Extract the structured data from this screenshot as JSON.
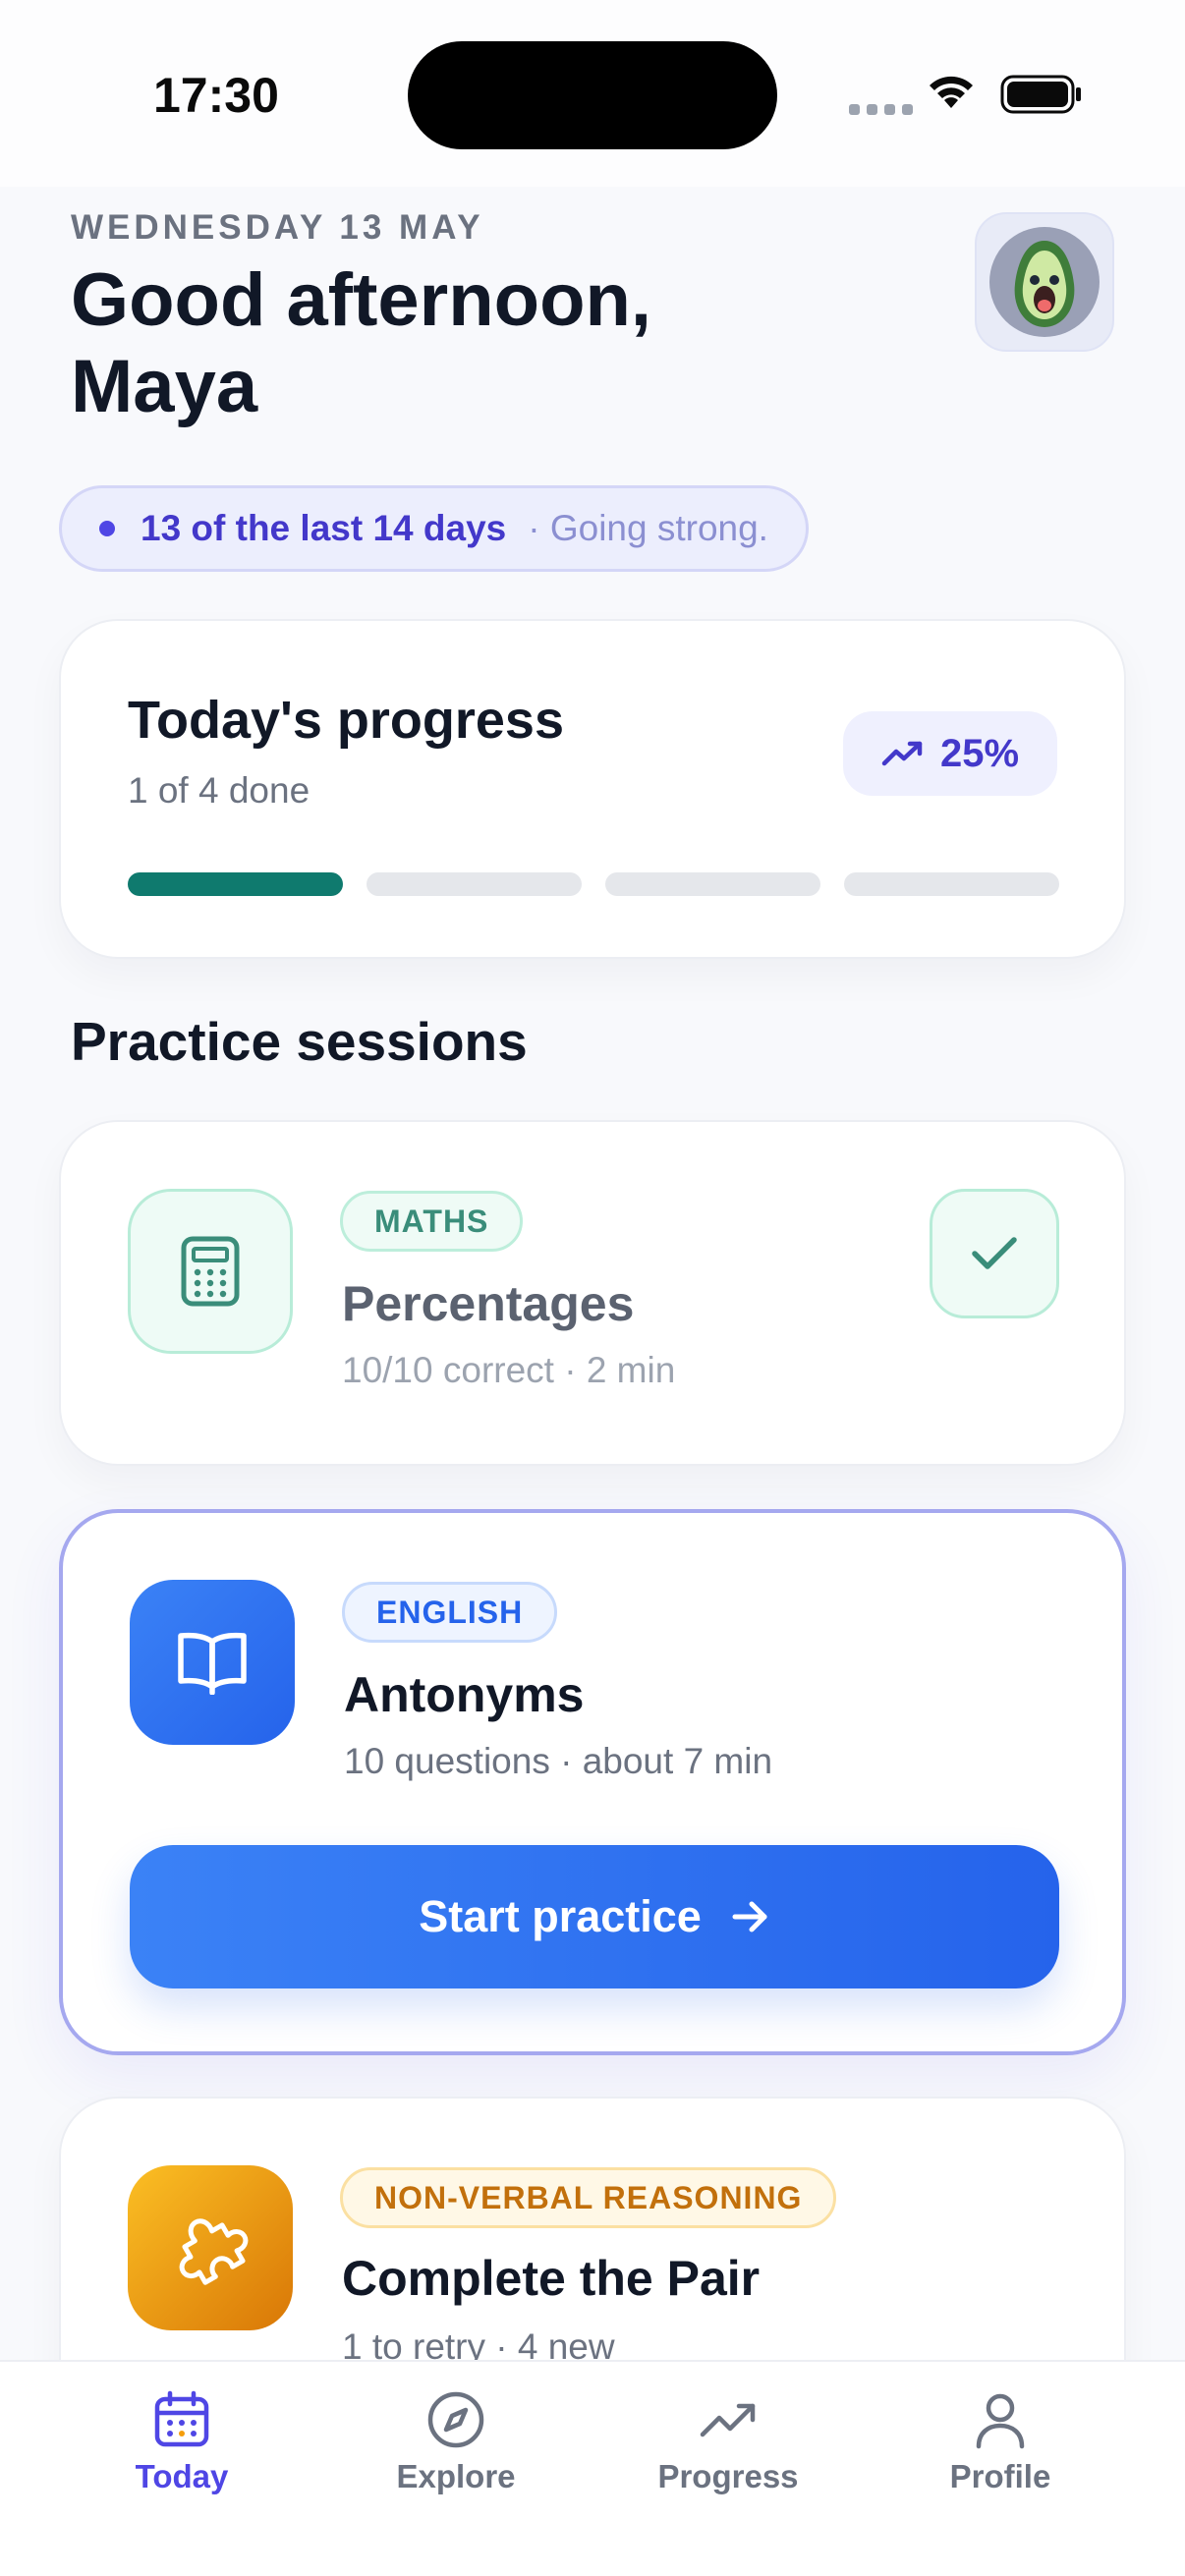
{
  "status_bar": {
    "time": "17:30"
  },
  "header": {
    "date": "WEDNESDAY 13 MAY",
    "greeting_line1": "Good afternoon,",
    "greeting_line2": "Maya",
    "avatar": "avocado-avatar"
  },
  "streak": {
    "main": "13 of the last 14 days",
    "note": "· Going strong."
  },
  "progress": {
    "title": "Today's progress",
    "subtitle": "1 of 4 done",
    "percent_label": "25%",
    "done": 1,
    "total": 4,
    "colors": {
      "done": "#0f7a6e",
      "pending": "#e5e7eb"
    }
  },
  "section_title": "Practice sessions",
  "sessions": [
    {
      "subject": "MATHS",
      "title": "Percentages",
      "meta": "10/10 correct · 2 min",
      "icon": "calculator-icon",
      "status": "completed",
      "accent": "#3a8d7a"
    },
    {
      "subject": "ENGLISH",
      "title": "Antonyms",
      "meta": "10 questions · about 7 min",
      "icon": "book-icon",
      "cta": "Start practice",
      "accent": "#2563eb"
    },
    {
      "subject": "NON-VERBAL REASONING",
      "title": "Complete the Pair",
      "meta": "1 to retry · 4 new",
      "icon": "puzzle-icon",
      "accent": "#c2700c"
    }
  ],
  "tabs": [
    {
      "label": "Today",
      "icon": "calendar-icon",
      "active": true
    },
    {
      "label": "Explore",
      "icon": "compass-icon",
      "active": false
    },
    {
      "label": "Progress",
      "icon": "trend-up-icon",
      "active": false
    },
    {
      "label": "Profile",
      "icon": "person-icon",
      "active": false
    }
  ],
  "colors": {
    "accent": "#4f46e5",
    "primary_button": "#2563eb"
  }
}
